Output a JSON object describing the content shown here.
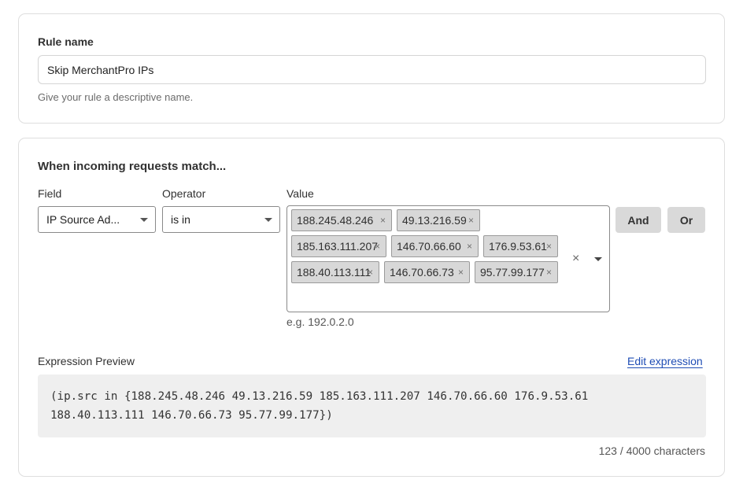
{
  "rule_name": {
    "label": "Rule name",
    "value": "Skip MerchantPro IPs",
    "helper": "Give your rule a descriptive name."
  },
  "match": {
    "heading": "When incoming requests match...",
    "field_label": "Field",
    "field_value": "IP Source Ad...",
    "operator_label": "Operator",
    "operator_value": "is in",
    "value_label": "Value",
    "chips": [
      "188.245.48.246",
      "49.13.216.59",
      "185.163.111.207",
      "146.70.66.60",
      "176.9.53.61",
      "188.40.113.111",
      "146.70.66.73",
      "95.77.99.177"
    ],
    "chip_remove_glyph": "×",
    "clear_glyph": "×",
    "value_hint": "e.g. 192.0.2.0",
    "and_label": "And",
    "or_label": "Or"
  },
  "expression": {
    "label": "Expression Preview",
    "edit_link": "Edit expression",
    "lines": [
      "(ip.src in {188.245.48.246 49.13.216.59 185.163.111.207 146.70.66.60 176.9.53.61",
      "188.40.113.111 146.70.66.73 95.77.99.177})"
    ],
    "char_count": "123 / 4000 characters"
  }
}
